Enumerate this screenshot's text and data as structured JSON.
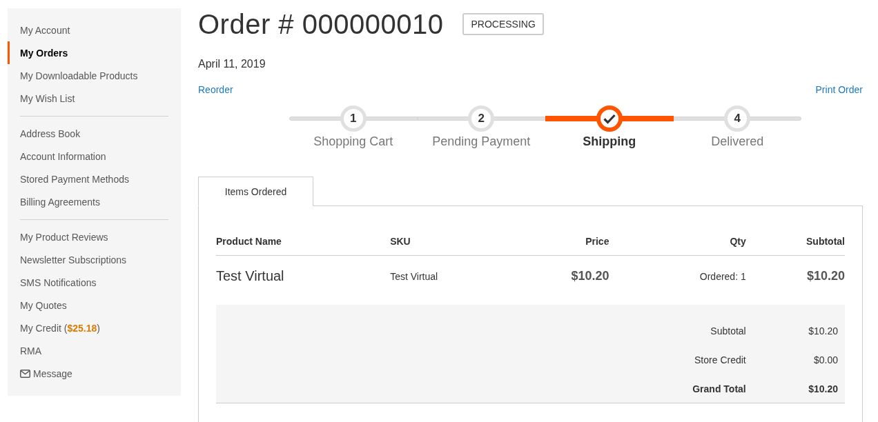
{
  "sidebar": {
    "groups": [
      {
        "items": [
          {
            "label": "My Account",
            "kind": "link",
            "selected": false
          },
          {
            "label": "My Orders",
            "kind": "link",
            "selected": true
          },
          {
            "label": "My Downloadable Products",
            "kind": "link",
            "selected": false
          },
          {
            "label": "My Wish List",
            "kind": "link",
            "selected": false
          }
        ]
      },
      {
        "items": [
          {
            "label": "Address Book",
            "kind": "link",
            "selected": false
          },
          {
            "label": "Account Information",
            "kind": "link",
            "selected": false
          },
          {
            "label": "Stored Payment Methods",
            "kind": "link",
            "selected": false
          },
          {
            "label": "Billing Agreements",
            "kind": "link",
            "selected": false
          }
        ]
      },
      {
        "items": [
          {
            "label": "My Product Reviews",
            "kind": "link",
            "selected": false
          },
          {
            "label": "Newsletter Subscriptions",
            "kind": "link",
            "selected": false
          },
          {
            "label": "SMS Notifications",
            "kind": "link",
            "selected": false
          },
          {
            "label": "My Quotes",
            "kind": "link",
            "selected": false
          },
          {
            "label": "My Credit (**$25.18**)",
            "kind": "link",
            "selected": false
          },
          {
            "label": "RMA",
            "kind": "link",
            "selected": false
          },
          {
            "label": "Message",
            "kind": "mail",
            "selected": false
          }
        ]
      }
    ]
  },
  "order": {
    "title": "Order # 000000010",
    "status": "PROCESSING",
    "date": "April 11, 2019",
    "reorder": "Reorder",
    "print": "Print Order"
  },
  "progress": {
    "steps": [
      {
        "number": "1",
        "label": "Shopping Cart",
        "selected": false
      },
      {
        "number": "2",
        "label": "Pending Payment",
        "selected": false
      },
      {
        "label": "Shipping",
        "selected": true
      },
      {
        "number": "4",
        "label": "Delivered",
        "selected": false
      }
    ]
  },
  "tabs": [
    {
      "label": "Items Ordered",
      "selected": true
    }
  ],
  "table": {
    "columns": [
      "Product Name",
      "SKU",
      "Price",
      "Qty",
      "Subtotal"
    ],
    "rows": [
      {
        "product_name": "Test Virtual",
        "sku": "Test Virtual",
        "price": "$10.20",
        "qty": "Ordered: 1",
        "subtotal": "$10.20"
      }
    ],
    "totals": [
      {
        "label": "Subtotal",
        "value": "$10.20",
        "kind": "plain"
      },
      {
        "label": "Store Credit",
        "value": "$0.00",
        "kind": "plain"
      },
      {
        "label": "Grand Total",
        "value": "$10.20",
        "kind": "grand"
      }
    ]
  }
}
